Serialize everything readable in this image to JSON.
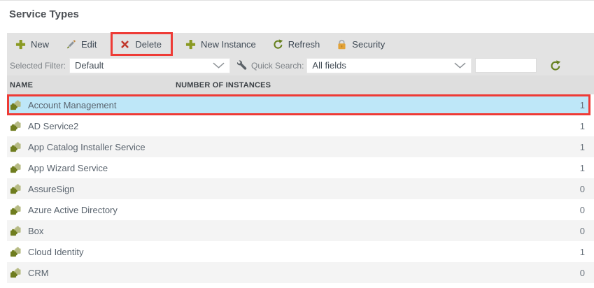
{
  "page": {
    "title": "Service Types"
  },
  "toolbar": {
    "buttons": [
      {
        "label": "New",
        "icon": "plus-icon"
      },
      {
        "label": "Edit",
        "icon": "pencil-icon"
      },
      {
        "label": "Delete",
        "icon": "delete-x-icon",
        "annotated": true
      },
      {
        "label": "New Instance",
        "icon": "plus-icon"
      },
      {
        "label": "Refresh",
        "icon": "refresh-icon"
      },
      {
        "label": "Security",
        "icon": "lock-icon"
      }
    ]
  },
  "filter_bar": {
    "selected_filter_label": "Selected Filter:",
    "selected_filter_value": "Default",
    "quick_search_label": "Quick Search:",
    "quick_search_scope": "All fields",
    "search_input_value": ""
  },
  "table": {
    "columns": [
      "NAME",
      "NUMBER OF INSTANCES"
    ],
    "rows": [
      {
        "name": "Account Management",
        "instances": "1",
        "selected": true
      },
      {
        "name": "AD Service2",
        "instances": "1"
      },
      {
        "name": "App Catalog Installer Service",
        "instances": "1"
      },
      {
        "name": "App Wizard Service",
        "instances": "1"
      },
      {
        "name": "AssureSign",
        "instances": "0"
      },
      {
        "name": "Azure Active Directory",
        "instances": "0"
      },
      {
        "name": "Box",
        "instances": "0"
      },
      {
        "name": "Cloud Identity",
        "instances": "1"
      },
      {
        "name": "CRM",
        "instances": "0"
      }
    ]
  },
  "annotations": {
    "highlight_color": "#ee3b36",
    "highlighted_elements": [
      "delete-button",
      "row-account-management"
    ]
  },
  "colors": {
    "accent_olive": "#8a9a23",
    "puzzle_dark": "#6f7d1f",
    "puzzle_light": "#b6ba83",
    "delete_red": "#c1392d",
    "lock_orange": "#e2a238",
    "selected_row_blue": "#bee7f8",
    "toolbar_bg": "#e3e3e3",
    "header_bg": "#dedede",
    "alt_row_bg": "#f4f4f4"
  }
}
